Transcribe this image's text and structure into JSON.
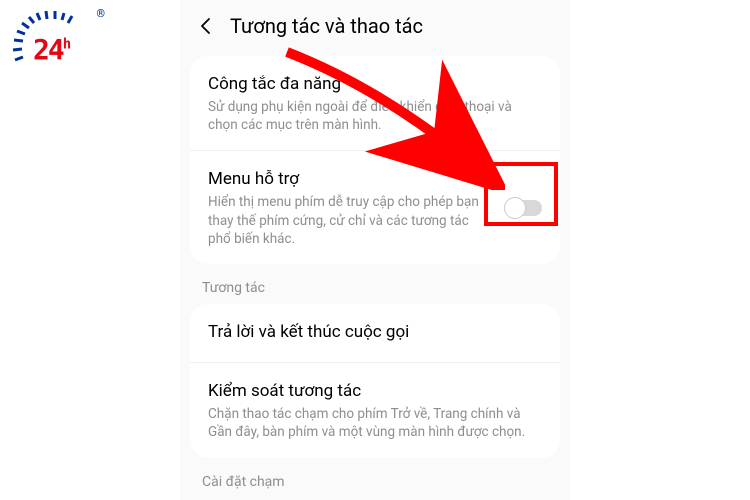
{
  "logo": {
    "text_main": "24",
    "text_suffix": "h",
    "registered": "®"
  },
  "header": {
    "title": "Tương tác và thao tác"
  },
  "section1": {
    "item1": {
      "title": "Công tắc đa năng",
      "desc": "Sử dụng phụ kiện ngoài để điều khiển điện thoại và chọn các mục trên màn hình."
    },
    "item2": {
      "title": "Menu hỗ trợ",
      "desc": "Hiển thị menu phím dễ truy cập cho phép bạn thay thế phím cứng, cử chỉ và các tương tác phổ biến khác."
    }
  },
  "section2": {
    "label": "Tương tác",
    "item1": {
      "title": "Trả lời và kết thúc cuộc gọi"
    },
    "item2": {
      "title": "Kiểm soát tương tác",
      "desc": "Chặn thao tác chạm cho phím Trở về, Trang chính và Gần đây, bàn phím và một vùng màn hình được chọn."
    }
  },
  "section3": {
    "label": "Cài đặt chạm"
  }
}
